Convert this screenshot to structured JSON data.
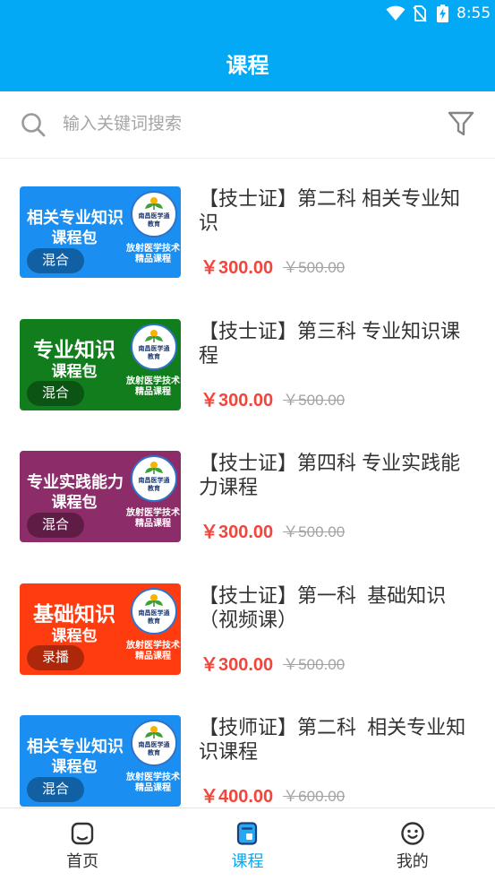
{
  "status_bar": {
    "time": "8:55",
    "icons": [
      "wifi-icon",
      "no-sim-icon",
      "battery-charging-icon"
    ]
  },
  "header": {
    "title": "课程"
  },
  "search": {
    "placeholder": "输入关键词搜索",
    "icon": "search-icon",
    "filter_icon": "filter-icon"
  },
  "colors": {
    "primary": "#03A9F4",
    "price": "#F2453B",
    "original_price": "#A3A3A3",
    "title_text": "#333333",
    "nav_inactive": "#333333"
  },
  "courses": [
    {
      "title": "【技士证】第二科 相关专业知识",
      "price": "￥300.00",
      "original_price": "￥500.00",
      "thumbnail": {
        "heading": "相关专业知识",
        "subheading": "课程包",
        "logo_name": "南昌医学通",
        "logo_sub": "教育",
        "tagline_1": "放射医学技术",
        "tagline_2": "精品课程",
        "badge": "混合",
        "color": "#1B8EF2"
      }
    },
    {
      "title": "【技士证】第三科 专业知识课程",
      "price": "￥300.00",
      "original_price": "￥500.00",
      "thumbnail": {
        "heading": "专业知识",
        "subheading": "课程包",
        "logo_name": "南昌医学通",
        "logo_sub": "教育",
        "tagline_1": "放射医学技术",
        "tagline_2": "精品课程",
        "badge": "混合",
        "color": "#117D1C"
      }
    },
    {
      "title": "【技士证】第四科 专业实践能力课程",
      "price": "￥300.00",
      "original_price": "￥500.00",
      "thumbnail": {
        "heading": "专业实践能力",
        "subheading": "课程包",
        "logo_name": "南昌医学通",
        "logo_sub": "教育",
        "tagline_1": "放射医学技术",
        "tagline_2": "精品课程",
        "badge": "混合",
        "color": "#8C2C68"
      }
    },
    {
      "title": "【技士证】第一科  基础知识（视频课）",
      "price": "￥300.00",
      "original_price": "￥500.00",
      "thumbnail": {
        "heading": "基础知识",
        "subheading": "课程包",
        "logo_name": "南昌医学通",
        "logo_sub": "教育",
        "tagline_1": "放射医学技术",
        "tagline_2": "精品课程",
        "badge": "录播",
        "color": "#FF3C10"
      }
    },
    {
      "title": "【技师证】第二科  相关专业知识课程",
      "price": "￥400.00",
      "original_price": "￥600.00",
      "thumbnail": {
        "heading": "相关专业知识",
        "subheading": "课程包",
        "logo_name": "南昌医学通",
        "logo_sub": "教育",
        "tagline_1": "放射医学技术",
        "tagline_2": "精品课程",
        "badge": "混合",
        "color": "#1B8EF2"
      }
    }
  ],
  "bottom_nav": [
    {
      "label": "首页",
      "icon": "home-icon",
      "active": false
    },
    {
      "label": "课程",
      "icon": "course-book-icon",
      "active": true
    },
    {
      "label": "我的",
      "icon": "smiley-profile-icon",
      "active": false
    }
  ]
}
